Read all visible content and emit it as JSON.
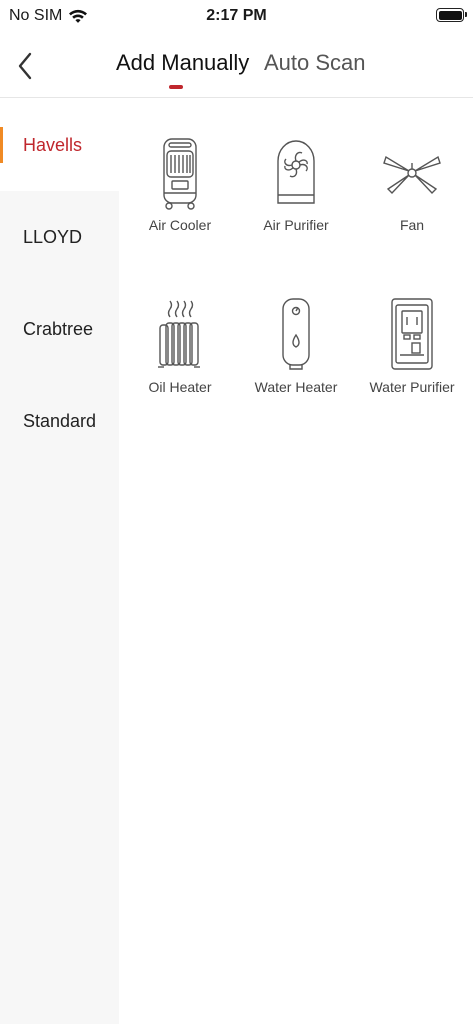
{
  "status_bar": {
    "carrier": "No SIM",
    "time": "2:17 PM"
  },
  "nav": {
    "tabs": [
      {
        "label": "Add Manually",
        "active": true
      },
      {
        "label": "Auto Scan",
        "active": false
      }
    ],
    "accent_color": "#c0272d"
  },
  "sidebar": {
    "items": [
      {
        "label": "Havells",
        "active": true
      },
      {
        "label": "LLOYD",
        "active": false
      },
      {
        "label": "Crabtree",
        "active": false
      },
      {
        "label": "Standard",
        "active": false
      }
    ]
  },
  "devices": [
    {
      "label": "Air Cooler",
      "icon": "air-cooler-icon"
    },
    {
      "label": "Air Purifier",
      "icon": "air-purifier-icon"
    },
    {
      "label": "Fan",
      "icon": "ceiling-fan-icon"
    },
    {
      "label": "Oil Heater",
      "icon": "oil-heater-icon"
    },
    {
      "label": "Water Heater",
      "icon": "water-heater-icon"
    },
    {
      "label": "Water Purifier",
      "icon": "water-purifier-icon"
    }
  ]
}
